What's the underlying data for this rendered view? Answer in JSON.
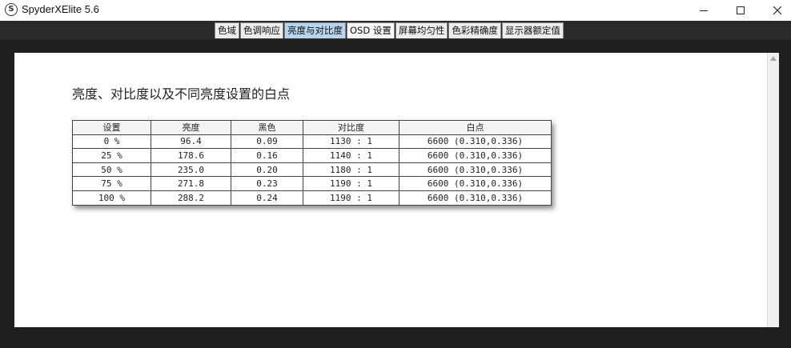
{
  "window": {
    "title": "SpyderXElite 5.6",
    "logo_letter": "S"
  },
  "tabs": [
    {
      "label": "色域"
    },
    {
      "label": "色调响应"
    },
    {
      "label": "亮度与对比度"
    },
    {
      "label": "OSD 设置"
    },
    {
      "label": "屏幕均匀性"
    },
    {
      "label": "色彩精确度"
    },
    {
      "label": "显示器额定值"
    }
  ],
  "active_tab": "亮度与对比度",
  "zoom_tools": [
    "zoom-in-icon",
    "zoom-out-icon",
    "zoom-fit-icon"
  ],
  "report": {
    "title": "亮度、对比度以及不同亮度设置的白点",
    "table": {
      "headers": [
        "设置",
        "亮度",
        "黑色",
        "对比度",
        "白点"
      ],
      "rows": [
        [
          "0 %",
          "96.4",
          "0.09",
          "1130 : 1",
          "6600 (0.310,0.336)"
        ],
        [
          "25 %",
          "178.6",
          "0.16",
          "1140 : 1",
          "6600 (0.310,0.336)"
        ],
        [
          "50 %",
          "235.0",
          "0.20",
          "1180 : 1",
          "6600 (0.310,0.336)"
        ],
        [
          "75 %",
          "271.8",
          "0.23",
          "1190 : 1",
          "6600 (0.310,0.336)"
        ],
        [
          "100 %",
          "288.2",
          "0.24",
          "1190 : 1",
          "6600 (0.310,0.336)"
        ]
      ]
    }
  },
  "colors": {
    "active_tab": "#b9d4ee",
    "app_background": "#1f1f1f",
    "panel": "#ffffff"
  }
}
